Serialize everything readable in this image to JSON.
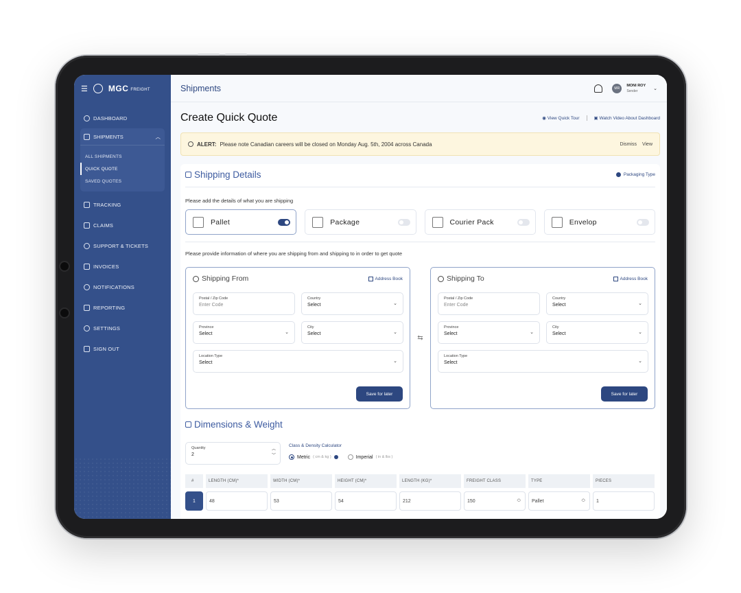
{
  "brand": {
    "name": "MGC",
    "sub": "FREIGHT"
  },
  "sidebar": {
    "items": [
      {
        "label": "DASHBOARD",
        "icon": "dashboard-icon"
      },
      {
        "label": "TRACKING",
        "icon": "tracking-icon"
      },
      {
        "label": "CLAIMS",
        "icon": "claims-icon"
      },
      {
        "label": "SUPPORT & TICKETS",
        "icon": "support-icon"
      },
      {
        "label": "INVOICES",
        "icon": "invoices-icon"
      },
      {
        "label": "NOTIFICATIONS",
        "icon": "bell-icon"
      },
      {
        "label": "REPORTING",
        "icon": "reporting-icon"
      },
      {
        "label": "SETTINGS",
        "icon": "settings-icon"
      },
      {
        "label": "SIGN OUT",
        "icon": "sign-out-icon"
      }
    ],
    "group": {
      "label": "SHIPMENTS",
      "sub": [
        "ALL SHIPMENTS",
        "QUICK QUOTE",
        "SAVED QUOTES"
      ],
      "active": "QUICK QUOTE"
    }
  },
  "topbar": {
    "title": "Shipments",
    "user": {
      "initials": "MR",
      "name": "MONI ROY",
      "role": "Sender"
    }
  },
  "page": {
    "title": "Create Quick Quote",
    "links": {
      "tour": "View Quick Tour",
      "video": "Watch Video About Dashboard"
    }
  },
  "alert": {
    "label": "ALERT:",
    "text": "Please note Canadian careers will be closed on Monday Aug. 5th, 2004 across Canada",
    "dismiss": "Dismiss",
    "view": "View"
  },
  "shipping_details": {
    "title": "Shipping Details",
    "packaging_type": "Packaging Type",
    "hint": "Please add the details of what you are shipping",
    "options": [
      {
        "label": "Pallet",
        "on": true
      },
      {
        "label": "Package",
        "on": false
      },
      {
        "label": "Courier Pack",
        "on": false
      },
      {
        "label": "Envelop",
        "on": false
      }
    ],
    "hint2": "Please provide information of where you are shipping from and shipping to in order to get quote"
  },
  "shipping_from": {
    "title": "Shipping From",
    "address_book": "Address Book",
    "postal_label": "Postal /  Zip Code",
    "postal_placeholder": "Enter Code",
    "country_label": "Country",
    "province_label": "Province",
    "city_label": "City",
    "location_label": "Location Type",
    "select": "Select",
    "save": "Save for later"
  },
  "shipping_to": {
    "title": "Shipping To",
    "address_book": "Address Book",
    "postal_label": "Postal /  Zip Code",
    "postal_placeholder": "Enter Code",
    "country_label": "Country",
    "province_label": "Province",
    "city_label": "City",
    "location_label": "Location Type",
    "select": "Select",
    "save": "Save for later"
  },
  "dimensions": {
    "title": "Dimensions & Weight",
    "quantity_label": "Quantity",
    "quantity_value": "2",
    "calc_title": "Class & Density Calculator",
    "metric": "Metric",
    "metric_units": "( cm & kg )",
    "imperial": "Imperial",
    "imperial_units": "( in & lbs )",
    "columns": [
      "#",
      "LENGTH (CM)*",
      "WIDTH (CM)*",
      "HEIGHT (CM)*",
      "LENGTH (KG)*",
      "FREIGHT CLASS",
      "TYPE",
      "PIECES"
    ],
    "row": [
      "1",
      "48",
      "53",
      "54",
      "212",
      "150",
      "Pallet",
      "1"
    ]
  },
  "colors": {
    "sidebar": "#34508a",
    "accent": "#2d4780",
    "alert_bg": "#fdf6df"
  }
}
